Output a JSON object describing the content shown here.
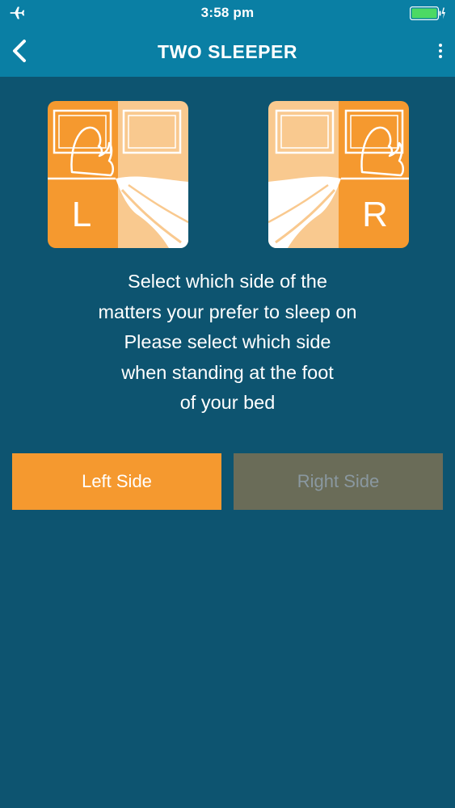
{
  "status_bar": {
    "time": "3:58 pm",
    "icons": [
      "airplane-icon",
      "battery-icon",
      "charging-bolt-icon"
    ],
    "battery_color": "#4cd964"
  },
  "nav": {
    "title": "TWO SLEEPER",
    "back_icon": "chevron-left-icon",
    "menu_icon": "more-vertical-icon"
  },
  "side_icons": {
    "left": {
      "letter": "L"
    },
    "right": {
      "letter": "R"
    }
  },
  "instructions": {
    "lines": [
      "Select which side of the",
      "matters your prefer to sleep on",
      "Please select which side",
      "when standing at the foot",
      "of your bed"
    ]
  },
  "buttons": {
    "left_label": "Left Side",
    "right_label": "Right Side"
  },
  "colors": {
    "background": "#0d5470",
    "header": "#0a7fa4",
    "accent_orange": "#f5992f",
    "light_orange": "#f9c98f",
    "disabled_button": "#6a6c58"
  }
}
